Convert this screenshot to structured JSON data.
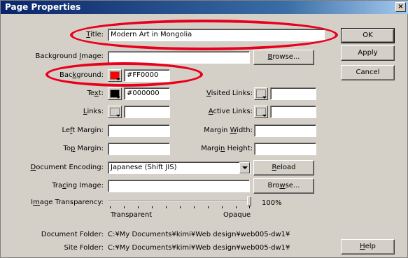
{
  "window": {
    "title": "Page Properties",
    "close_glyph": "×"
  },
  "fields": {
    "title": {
      "label_pre": "",
      "label_u": "T",
      "label_post": "itle:",
      "value": "Modern Art in Mongolia"
    },
    "background_image": {
      "label_pre": "Background ",
      "label_u": "I",
      "label_post": "mage:",
      "value": ""
    },
    "background": {
      "label_pre": "Bac",
      "label_u": "k",
      "label_post": "ground:",
      "value": "#FF0000",
      "color": "#ff0000"
    },
    "text": {
      "label_pre": "Te",
      "label_u": "x",
      "label_post": "t:",
      "value": "#000000",
      "color": "#000000"
    },
    "links": {
      "label_pre": "",
      "label_u": "L",
      "label_post": "inks:",
      "value": ""
    },
    "visited_links": {
      "label_pre": "",
      "label_u": "V",
      "label_post": "isited Links:",
      "value": ""
    },
    "active_links": {
      "label_pre": "",
      "label_u": "A",
      "label_post": "ctive Links:",
      "value": ""
    },
    "left_margin": {
      "label_pre": "Le",
      "label_u": "f",
      "label_post": "t Margin:",
      "value": ""
    },
    "top_margin": {
      "label_pre": "To",
      "label_u": "p",
      "label_post": " Margin:",
      "value": ""
    },
    "margin_width": {
      "label_pre": "Margin ",
      "label_u": "W",
      "label_post": "idth:",
      "value": ""
    },
    "margin_height": {
      "label_pre": "Margi",
      "label_u": "n",
      "label_post": " Height:",
      "value": ""
    },
    "document_encoding": {
      "label_pre": "",
      "label_u": "D",
      "label_post": "ocument Encoding:",
      "value": "Japanese (Shift JIS)"
    },
    "tracing_image": {
      "label_pre": "Tra",
      "label_u": "c",
      "label_post": "ing Image:",
      "value": ""
    },
    "image_transparency": {
      "label_pre": "I",
      "label_u": "m",
      "label_post": "age Transparency:",
      "value": "100%",
      "level": 1.0,
      "left_label": "Transparent",
      "right_label": "Opaque"
    }
  },
  "buttons": {
    "ok": "OK",
    "apply": "Apply",
    "cancel": "Cancel",
    "browse_1": {
      "pre": "",
      "u": "B",
      "post": "rowse..."
    },
    "reload": {
      "pre": "",
      "u": "R",
      "post": "eload"
    },
    "browse_2": {
      "pre": "Bro",
      "u": "w",
      "post": "se..."
    },
    "help": {
      "pre": "",
      "u": "H",
      "post": "elp"
    }
  },
  "info": {
    "document_folder_label": "Document Folder:",
    "document_folder_value": "C:¥My Documents¥kimi¥Web design¥web005-dw1¥",
    "site_folder_label": "Site Folder:",
    "site_folder_value": "C:¥My Documents¥kimi¥Web design¥web005-dw1¥"
  },
  "annotation_color": "#e8001c"
}
